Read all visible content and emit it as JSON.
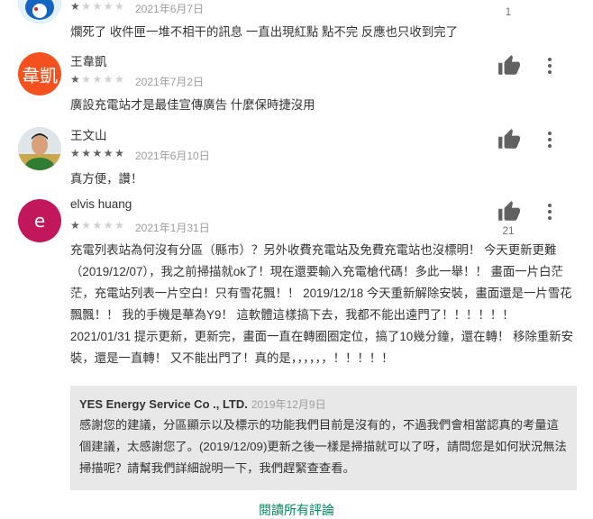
{
  "reviews": [
    {
      "name": "",
      "date": "2021年6月7日",
      "rating": 1,
      "text": "爛死了 收件匣一堆不相干的訊息 一直出現紅點 點不完 反應也只收到完了",
      "helpful_count": "1"
    },
    {
      "name": "王韋凱",
      "avatar_text": "韋凱",
      "avatar_color": "#f4511e",
      "date": "2021年7月2日",
      "rating": 1,
      "text": "廣設充電站才是最佳宣傳廣告 什麼保時捷沒用",
      "helpful_count": ""
    },
    {
      "name": "王文山",
      "date": "2021年6月10日",
      "rating": 5,
      "text": "真方便，讚！",
      "helpful_count": ""
    },
    {
      "name": "elvis huang",
      "avatar_text": "e",
      "avatar_color": "#c2185b",
      "date": "2021年1月31日",
      "rating": 1,
      "text": "充電列表站為何沒有分區（縣市）？另外收費充電站及免費充電站也沒標明！ 今天更新更難（2019/12/07），我之前掃描就ok了！現在還要輸入充電槍代碼！多此一舉！！ 畫面一片白茫茫，充電站列表一片空白！只有雪花飄！！ 2019/12/18 今天重新解除安裝，畫面還是一片雪花飄飄！！ 我的手機是華為Y9！ 這軟體這樣搞下去，我都不能出遠門了！！！！！！ 2021/01/31 提示更新，更新完，畫面一直在轉圈圈定位，搞了10幾分鐘，還在轉！ 移除重新安裝，還是一直轉！ 又不能出門了！真的是，，，，，，！！！！！",
      "helpful_count": "21"
    }
  ],
  "developer_reply": {
    "developer": "YES Energy Service Co ., LTD.",
    "date": "2019年12月9日",
    "text": "感謝您的建議，分區顯示以及標示的功能我們目前是沒有的，不過我們會相當認真的考量這個建議，太感謝您了。(2019/12/09)更新之後一樣是掃描就可以了呀，請問您是如何狀況無法掃描呢？請幫我們詳細說明一下，我們趕緊查查看。"
  },
  "read_all_label": "閱讀所有評論",
  "icons": {
    "helpful": "thumb-up-icon",
    "more": "more-vert-icon"
  },
  "colors": {
    "accent": "#01875f",
    "reply_background": "#e8e8e8"
  }
}
